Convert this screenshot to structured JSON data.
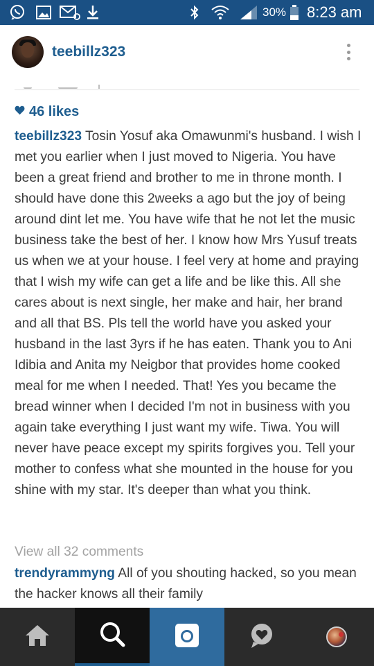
{
  "status_bar": {
    "icons": [
      "whatsapp-icon",
      "gallery-icon",
      "email-icon",
      "download-icon",
      "bluetooth-icon",
      "wifi-icon",
      "signal-icon",
      "battery-icon"
    ],
    "battery": "30%",
    "time": "8:23 am"
  },
  "header": {
    "username": "teebillz323",
    "menu_icon": "more-vertical-icon"
  },
  "post": {
    "likes": {
      "icon": "heart-icon",
      "text": "46 likes"
    },
    "caption": {
      "author": "teebillz323",
      "text": "Tosin Yosuf aka Omawunmi's husband. I wish I met you earlier when I just moved to Nigeria. You have been a great friend and brother to me in throne month. I should have done this 2weeks a ago but the joy of being around dint let me. You have wife that he not let the music business take the best of her. I know how Mrs Yusuf treats us when we at your house. I feel very at home and praying that I wish my wife can get a life and be like this. All she cares about is next single, her make and hair, her brand and all that BS. Pls tell the world have you asked your husband in the last 3yrs if he has eaten. Thank you to Ani Idibia and Anita my Neigbor that provides home cooked meal for me when I needed. That! Yes you became the bread winner when I decided I'm not in business with you again take everything I just want my wife. Tiwa. You will never have peace except my spirits forgives you. Tell your mother to confess what she mounted in the house for you shine with my star. It's deeper than what you think."
    },
    "view_all_comments": "View all 32 comments",
    "comments": [
      {
        "author": "trendyrammyng",
        "text": "All of you shouting hacked, so you mean the hacker knows all their family"
      }
    ]
  },
  "bottom_nav": {
    "items": [
      "home-icon",
      "search-icon",
      "camera-icon",
      "activity-icon",
      "profile-avatar"
    ],
    "active": "search-icon",
    "accent": "#1e5d8f"
  },
  "colors": {
    "status_bar": "#1a5084",
    "link": "#1e5d8f",
    "text": "#3c3c3c",
    "muted": "#a3a3a3",
    "nav_bg": "#2b2b2b"
  }
}
